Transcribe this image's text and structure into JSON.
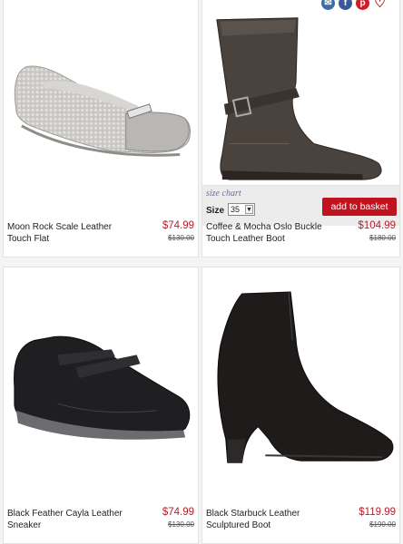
{
  "products": [
    {
      "name": "Moon Rock Scale Leather Touch Flat",
      "price": "$74.99",
      "was_price": "$130.00"
    },
    {
      "name": "Coffee & Mocha Oslo Buckle Touch Leather Boot",
      "price": "$104.99",
      "was_price": "$180.00"
    },
    {
      "name": "Black Feather Cayla Leather Sneaker",
      "price": "$74.99",
      "was_price": "$130.00"
    },
    {
      "name": "Black Starbuck Leather Sculptured Boot",
      "price": "$119.99",
      "was_price": "$190.00"
    }
  ],
  "hover_panel": {
    "size_chart_label": "size chart",
    "size_label": "Size",
    "size_value": "35",
    "add_button_label": "add to basket"
  },
  "social_icons": [
    "email-icon",
    "facebook-icon",
    "pinterest-icon",
    "heart-icon"
  ],
  "colors": {
    "price": "#b3202a",
    "add_button": "#c1121f",
    "size_chart_link": "#6b6b9c"
  }
}
